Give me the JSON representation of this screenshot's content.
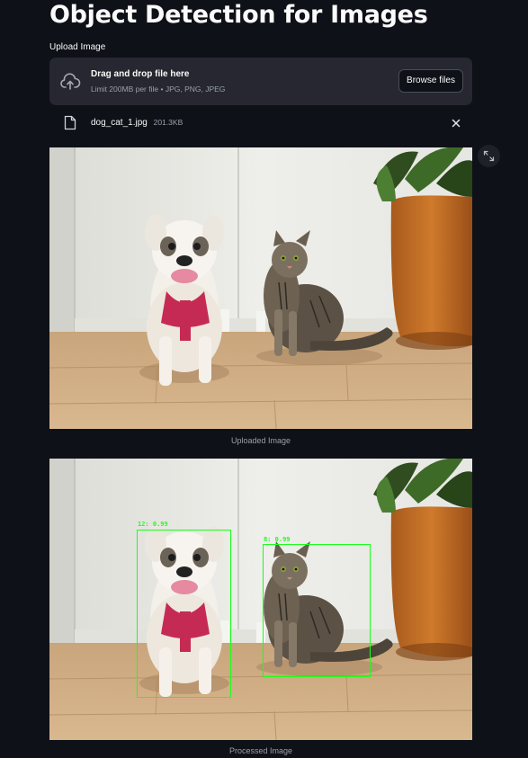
{
  "page": {
    "title": "Object Detection for Images"
  },
  "uploader": {
    "label": "Upload Image",
    "drop_title": "Drag and drop file here",
    "drop_limit": "Limit 200MB per file • JPG, PNG, JPEG",
    "browse_label": "Browse files",
    "icon": "cloud-upload-icon"
  },
  "file": {
    "name": "dog_cat_1.jpg",
    "size": "201.3KB",
    "icon": "file-icon",
    "remove_icon": "close-icon"
  },
  "images": [
    {
      "caption": "Uploaded Image"
    },
    {
      "caption": "Processed Image"
    }
  ],
  "detections": [
    {
      "label": "12: 0.99",
      "object": "dog"
    },
    {
      "label": "8: 0.99",
      "object": "cat"
    }
  ],
  "colors": {
    "background": "#0e1117",
    "dropzone": "#262730",
    "bbox": "#1aff1a",
    "muted_text": "#9aa0ab"
  }
}
